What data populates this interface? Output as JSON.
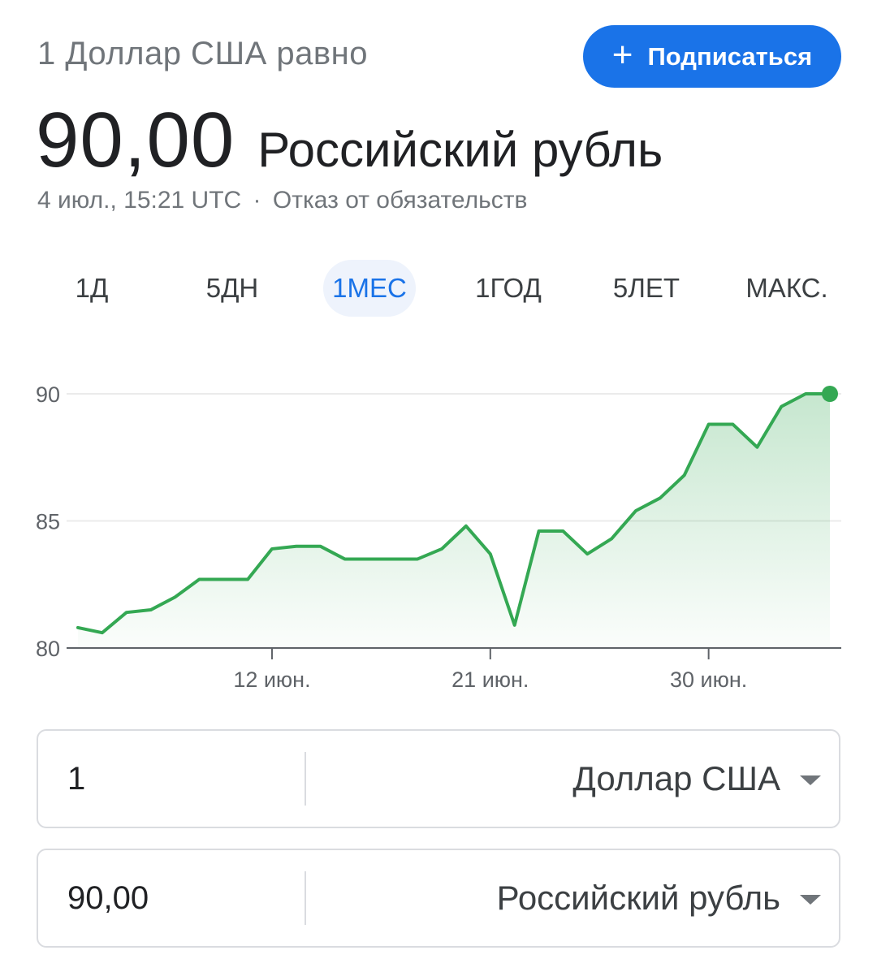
{
  "header": {
    "subtitle": "1 Доллар США равно",
    "subscribe_label": "Подписаться",
    "subscribe_icon": "plus-icon"
  },
  "rate": {
    "value": "90,00",
    "currency": "Российский рубль"
  },
  "meta": {
    "timestamp": "4 июл., 15:21 UTC",
    "separator": "·",
    "disclaimer": "Отказ от обязательств"
  },
  "tabs": [
    {
      "label": "1Д",
      "active": false
    },
    {
      "label": "5ДН",
      "active": false
    },
    {
      "label": "1МЕС",
      "active": true
    },
    {
      "label": "1ГОД",
      "active": false
    },
    {
      "label": "5ЛЕТ",
      "active": false
    },
    {
      "label": "МАКС.",
      "active": false
    }
  ],
  "colors": {
    "line": "#34a853",
    "accent": "#1a73e8",
    "axis": "#5f6368",
    "grid": "#ebebeb"
  },
  "chart_data": {
    "type": "area",
    "title": "",
    "xlabel": "",
    "ylabel": "",
    "ylim": [
      80,
      90
    ],
    "yticks": [
      90,
      85,
      80
    ],
    "xtick_labels": [
      "12 июн.",
      "21 июн.",
      "30 июн."
    ],
    "xtick_days": [
      12,
      21,
      30
    ],
    "grid": true,
    "series": [
      {
        "x_days": [
          4,
          5,
          6,
          7,
          8,
          9,
          10,
          11,
          12,
          13,
          14,
          15,
          16,
          17,
          18,
          19,
          20,
          21,
          22,
          23,
          24,
          25,
          26,
          27,
          28,
          29,
          30,
          31,
          32,
          33,
          34,
          35
        ],
        "x_labels": [
          "4 июн.",
          "5 июн.",
          "6 июн.",
          "7 июн.",
          "8 июн.",
          "9 июн.",
          "10 июн.",
          "11 июн.",
          "12 июн.",
          "13 июн.",
          "14 июн.",
          "15 июн.",
          "16 июн.",
          "17 июн.",
          "18 июн.",
          "19 июн.",
          "20 июн.",
          "21 июн.",
          "22 июн.",
          "23 июн.",
          "24 июн.",
          "25 июн.",
          "26 июн.",
          "27 июн.",
          "28 июн.",
          "29 июн.",
          "30 июн.",
          "1 июл.",
          "2 июл.",
          "3 июл.",
          "4 июл.",
          "5 июл."
        ],
        "values": [
          80.8,
          80.6,
          81.4,
          81.5,
          82.0,
          82.7,
          82.7,
          82.7,
          83.9,
          84.0,
          84.0,
          83.5,
          83.5,
          83.5,
          83.5,
          83.9,
          84.8,
          83.7,
          80.9,
          84.6,
          84.6,
          83.7,
          84.3,
          85.4,
          85.9,
          86.8,
          88.8,
          88.8,
          87.9,
          89.5,
          90.0,
          90.0
        ]
      }
    ]
  },
  "converter": {
    "from_amount": "1",
    "from_currency": "Доллар США",
    "to_amount": "90,00",
    "to_currency": "Российский рубль"
  }
}
